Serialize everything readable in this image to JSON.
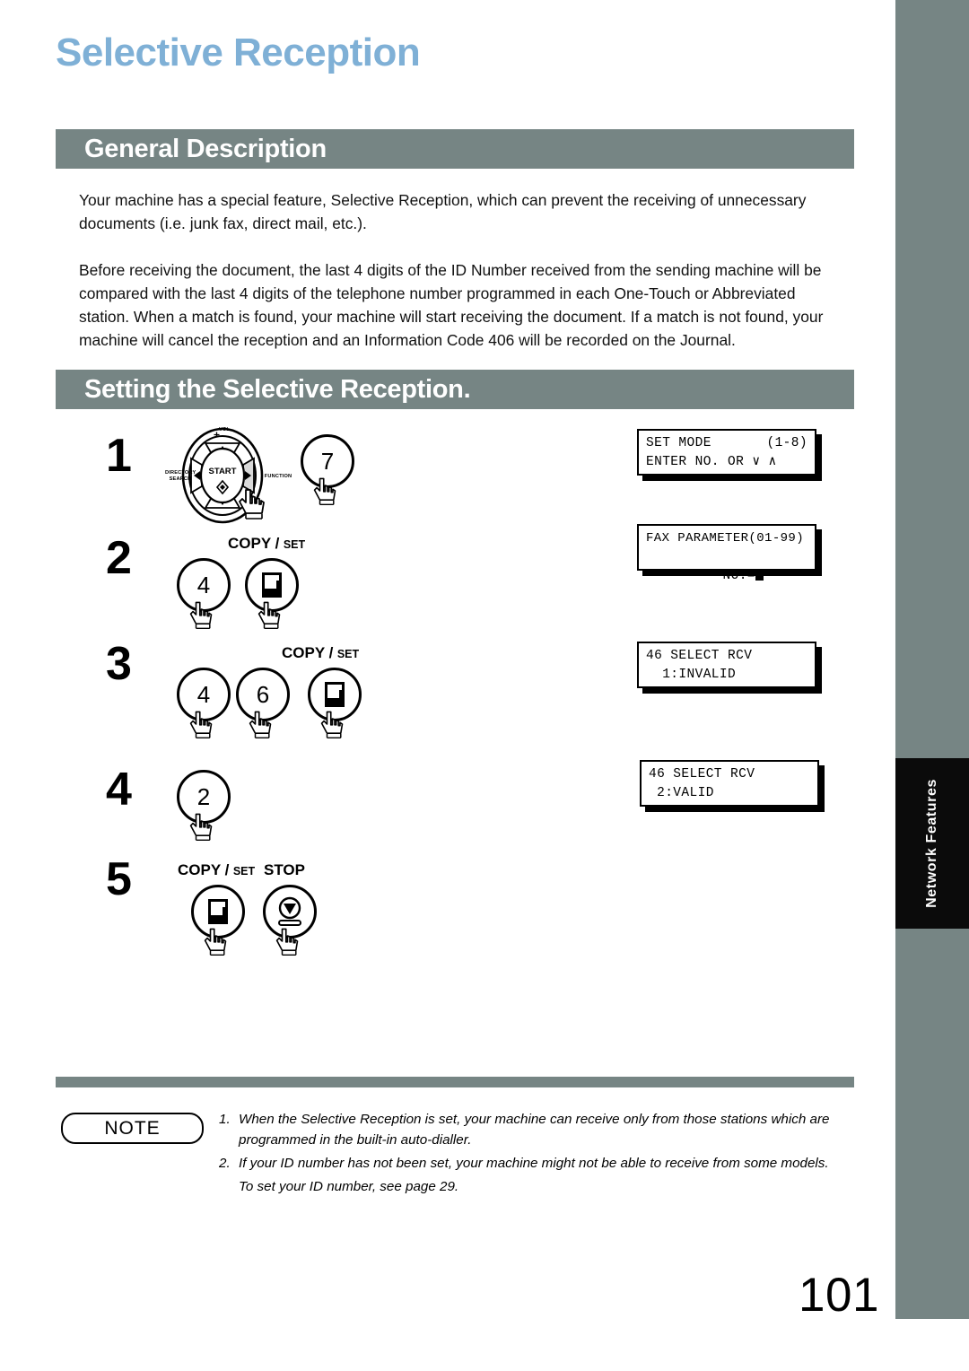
{
  "page": {
    "title": "Selective Reception",
    "number": "101",
    "side_tab_label": "Network Features",
    "accent_gray": "#768584",
    "title_blue": "#7fb0d6"
  },
  "sections": [
    {
      "id": "general",
      "heading": "General Description",
      "paragraphs": [
        "Your machine has a special feature, Selective Reception, which can prevent the receiving of unnecessary documents (i.e. junk fax, direct mail, etc.).",
        "Before receiving the document, the last 4 digits of the ID Number received from the sending machine will be compared with the last 4 digits of the telephone number programmed in each One-Touch or Abbreviated station. When a match is found, your machine will start receiving the document. If a match is not found, your machine will cancel the reception and an Information Code 406 will be recorded on the Journal."
      ]
    },
    {
      "id": "setting",
      "heading": "Setting the Selective Reception."
    }
  ],
  "dial": {
    "center_label": "START",
    "top_label": "VOL.",
    "left_label_line1": "DIRECTORY",
    "left_label_line2": "SEARCH",
    "right_label": "FUNCTION"
  },
  "steps": [
    {
      "number": "1",
      "has_dial": true,
      "keys": [
        {
          "type": "digit",
          "label": "7"
        }
      ],
      "key_group_label": null
    },
    {
      "number": "2",
      "has_dial": false,
      "keys": [
        {
          "type": "digit",
          "label": "4"
        },
        {
          "type": "copyset",
          "label": ""
        }
      ],
      "key_group_label": {
        "big": "COPY",
        "slash": "/",
        "small": "SET"
      }
    },
    {
      "number": "3",
      "has_dial": false,
      "keys": [
        {
          "type": "digit",
          "label": "4"
        },
        {
          "type": "digit",
          "label": "6"
        },
        {
          "type": "copyset",
          "label": ""
        }
      ],
      "key_group_label": {
        "big": "COPY",
        "slash": "/",
        "small": "SET"
      }
    },
    {
      "number": "4",
      "has_dial": false,
      "keys": [
        {
          "type": "digit",
          "label": "2"
        }
      ],
      "key_group_label": null
    },
    {
      "number": "5",
      "has_dial": false,
      "keys": [
        {
          "type": "copyset",
          "label": ""
        },
        {
          "type": "stop",
          "label": ""
        }
      ],
      "key_group_label": {
        "big": "COPY",
        "slash": "/",
        "small": "SET"
      },
      "extra_label": "STOP"
    }
  ],
  "displays": [
    {
      "id": "lcd-1",
      "line1_left": "SET MODE",
      "line1_right": "(1-8)",
      "line2": "ENTER NO. OR ∨ ∧",
      "layout": "split"
    },
    {
      "id": "lcd-2",
      "line1": "FAX PARAMETER(01-99)",
      "line2_prefix": "NO.=",
      "line2_cursor": true,
      "layout": "centered-second"
    },
    {
      "id": "lcd-3",
      "line1": "46 SELECT RCV",
      "line2": "  1:INVALID",
      "layout": "plain"
    },
    {
      "id": "lcd-4",
      "line1": "46 SELECT RCV",
      "line2": " 2:VALID",
      "layout": "plain"
    }
  ],
  "note": {
    "badge": "NOTE",
    "items": [
      {
        "index": "1.",
        "text": "When the Selective Reception is set, your machine can receive only from those stations which are programmed in the built-in auto-dialler."
      },
      {
        "index": "2.",
        "text": "If your ID number has not been set, your machine might not be able to receive from some models."
      }
    ],
    "sub_text": "To set your ID number, see page 29."
  }
}
